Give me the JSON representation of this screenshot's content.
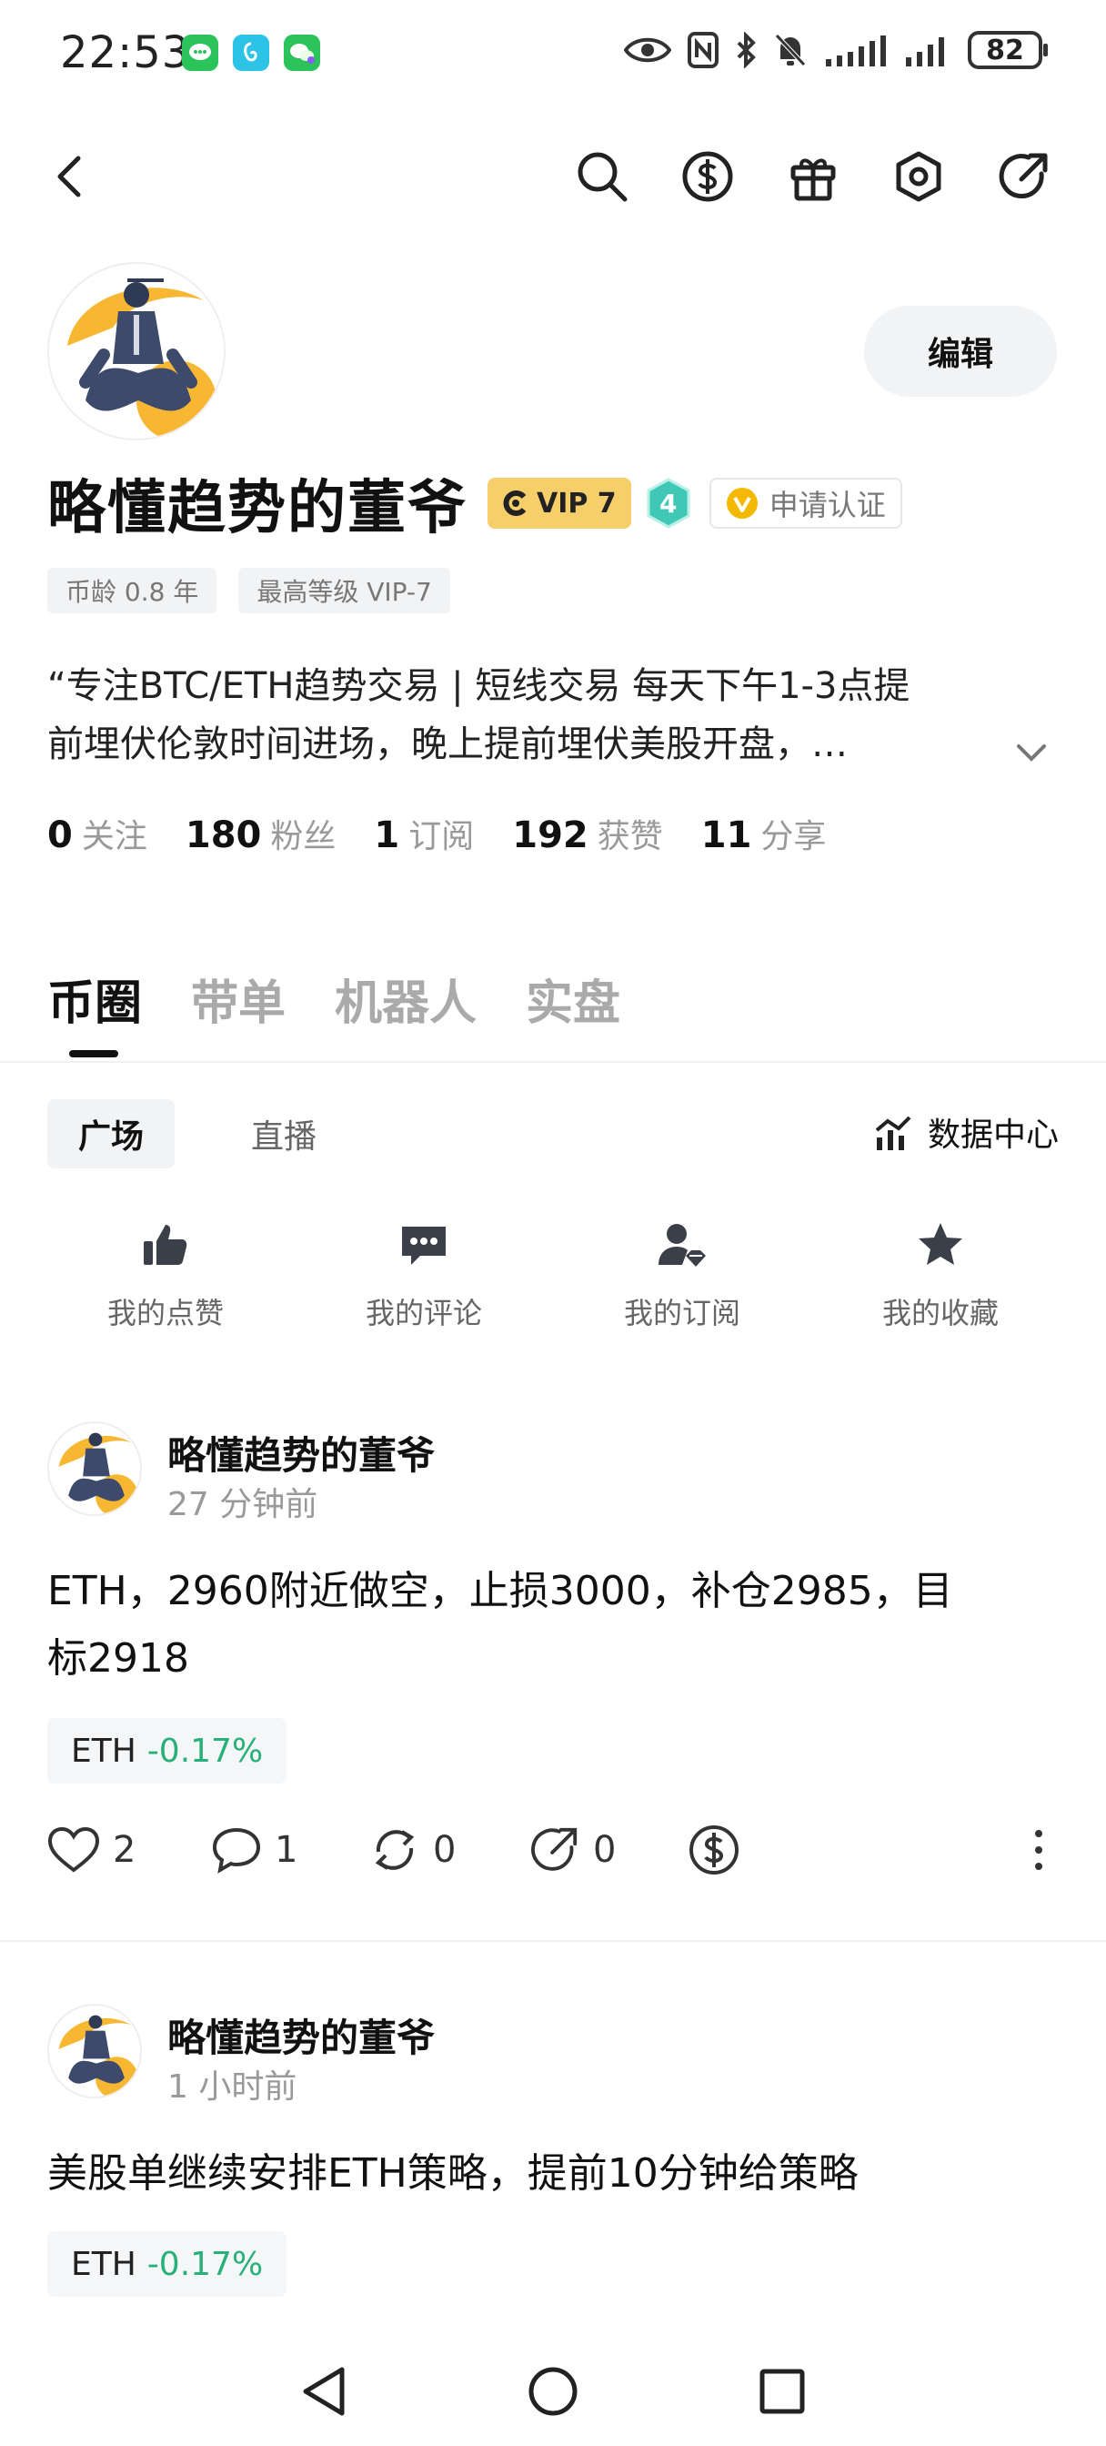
{
  "status_bar": {
    "time": "22:53",
    "battery": "82",
    "app_icons": [
      "chat-app-icon",
      "app-icon",
      "chat-app-icon"
    ],
    "system_icons": [
      "eye-icon",
      "nfc-icon",
      "bluetooth-icon",
      "mute-bell-icon",
      "signal-icon",
      "signal-icon"
    ]
  },
  "top_nav": {
    "back": "back-icon",
    "icons": [
      "search-icon",
      "dollar-icon",
      "gift-icon",
      "settings-icon",
      "share-icon"
    ]
  },
  "profile": {
    "name": "略懂趋势的董爷",
    "vip_label": "VIP 7",
    "level": "4",
    "verify_label": "申请认证",
    "edit_label": "编辑",
    "tags": [
      "币龄 0.8 年",
      "最高等级 VIP-7"
    ],
    "bio_line1": "“专注BTC/ETH趋势交易 | 短线交易 每天下午1-3点提",
    "bio_line2": "前埋伏伦敦时间进场，晚上提前埋伏美股开盘，…",
    "stats": [
      {
        "value": "0",
        "label": "关注"
      },
      {
        "value": "180",
        "label": "粉丝"
      },
      {
        "value": "1",
        "label": "订阅"
      },
      {
        "value": "192",
        "label": "获赞"
      },
      {
        "value": "11",
        "label": "分享"
      }
    ]
  },
  "tabs": [
    "币圈",
    "带单",
    "机器人",
    "实盘"
  ],
  "subtabs": {
    "square": "广场",
    "live": "直播",
    "data_center": "数据中心"
  },
  "shortcuts": [
    {
      "label": "我的点赞",
      "icon": "thumbs-up-icon"
    },
    {
      "label": "我的评论",
      "icon": "comment-icon"
    },
    {
      "label": "我的订阅",
      "icon": "subscription-icon"
    },
    {
      "label": "我的收藏",
      "icon": "star-icon"
    }
  ],
  "posts": [
    {
      "author": "略懂趋势的董爷",
      "time": "27 分钟前",
      "text_line1": "ETH，2960附近做空，止损3000，补仓2985，目",
      "text_line2": "标2918",
      "ticker_symbol": "ETH",
      "ticker_change": "-0.17%",
      "likes": "2",
      "comments": "1",
      "reposts": "0",
      "shares": "0"
    },
    {
      "author": "略懂趋势的董爷",
      "time": "1 小时前",
      "text_line1": "美股单继续安排ETH策略，提前10分钟给策略",
      "ticker_symbol": "ETH",
      "ticker_change": "-0.17%"
    }
  ],
  "colors": {
    "vip_gold": "#f6cf6a",
    "level_teal": "#3fc8b5",
    "positive_green": "#27b07a",
    "verify_gold": "#f5b800"
  }
}
